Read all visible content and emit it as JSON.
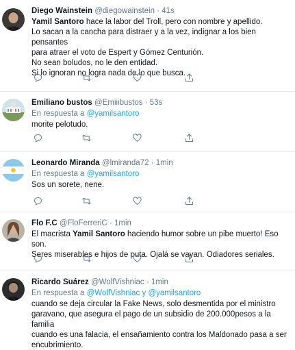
{
  "tweets": [
    {
      "name": "Diego Wainstein",
      "handle": "@diegowainstein",
      "time": "41s",
      "reply_prefix": "",
      "reply_users": [],
      "lines": [
        [
          "Yamil Santoro",
          " hace la labor del Troll, pero con nombre y apellido."
        ],
        [
          "",
          "Lo sacan a la cancha para distraer y a la vez, indignar a los bien pensantes"
        ],
        [
          "",
          "para atraer el voto de Espert y Gómez Centurión."
        ],
        [
          "",
          "No sean boludos, no le den entidad."
        ],
        [
          "",
          "Si lo ignoran no logra nada de lo que busca."
        ]
      ]
    },
    {
      "name": "Emiliano bustos",
      "handle": "@Emiiibustos",
      "time": "53s",
      "reply_prefix": "En respuesta a",
      "reply_users": [
        "@yamilsantoro"
      ],
      "lines": [
        [
          "",
          "morite pelotudo."
        ]
      ]
    },
    {
      "name": "Leonardo Miranda",
      "handle": "@lmiranda72",
      "time": "1min",
      "reply_prefix": "En respuesta a",
      "reply_users": [
        "@yamilsantoro"
      ],
      "lines": [
        [
          "",
          "Sos un sorete, nene."
        ]
      ]
    },
    {
      "name": "Flo F.C",
      "handle": "@FloFerreriC",
      "time": "1min",
      "reply_prefix": "",
      "reply_users": [],
      "lines": [
        [
          "",
          "El macrista "
        ],
        [
          "",
          "Seres miserables e hijos de puta. Ojalá se vayan. Odiadores seriales."
        ]
      ],
      "first_line": [
        "El macrista ",
        "Yamil Santoro",
        " haciendo humor sobre un pibe muerto! Eso son."
      ]
    },
    {
      "name": "Ricardo Suárez",
      "handle": "@WolfVishniac",
      "time": "1min",
      "reply_prefix": "En respuesta a",
      "reply_users": [
        "@WolfVishniac",
        "@yamilsantoro"
      ],
      "reply_joiner": "y",
      "lines": [
        [
          "",
          "cuando se deja circular la Fake News, solo desmentida por el ministro"
        ],
        [
          "",
          "garavano, que asegura el pago de un subsidio de 200.000pesos a la familia"
        ],
        [
          "",
          "cuando es una falacia, el ensañamiento contra los Maldonado pasa a ser"
        ],
        [
          "",
          "encubrimiento."
        ]
      ]
    }
  ],
  "separator": "·",
  "icons": {
    "reply": "reply-icon",
    "retweet": "retweet-icon",
    "like": "like-icon",
    "share": "share-icon"
  },
  "colors": {
    "link": "#1da1f2",
    "secondary": "#657786",
    "border": "#e6ecf0"
  }
}
